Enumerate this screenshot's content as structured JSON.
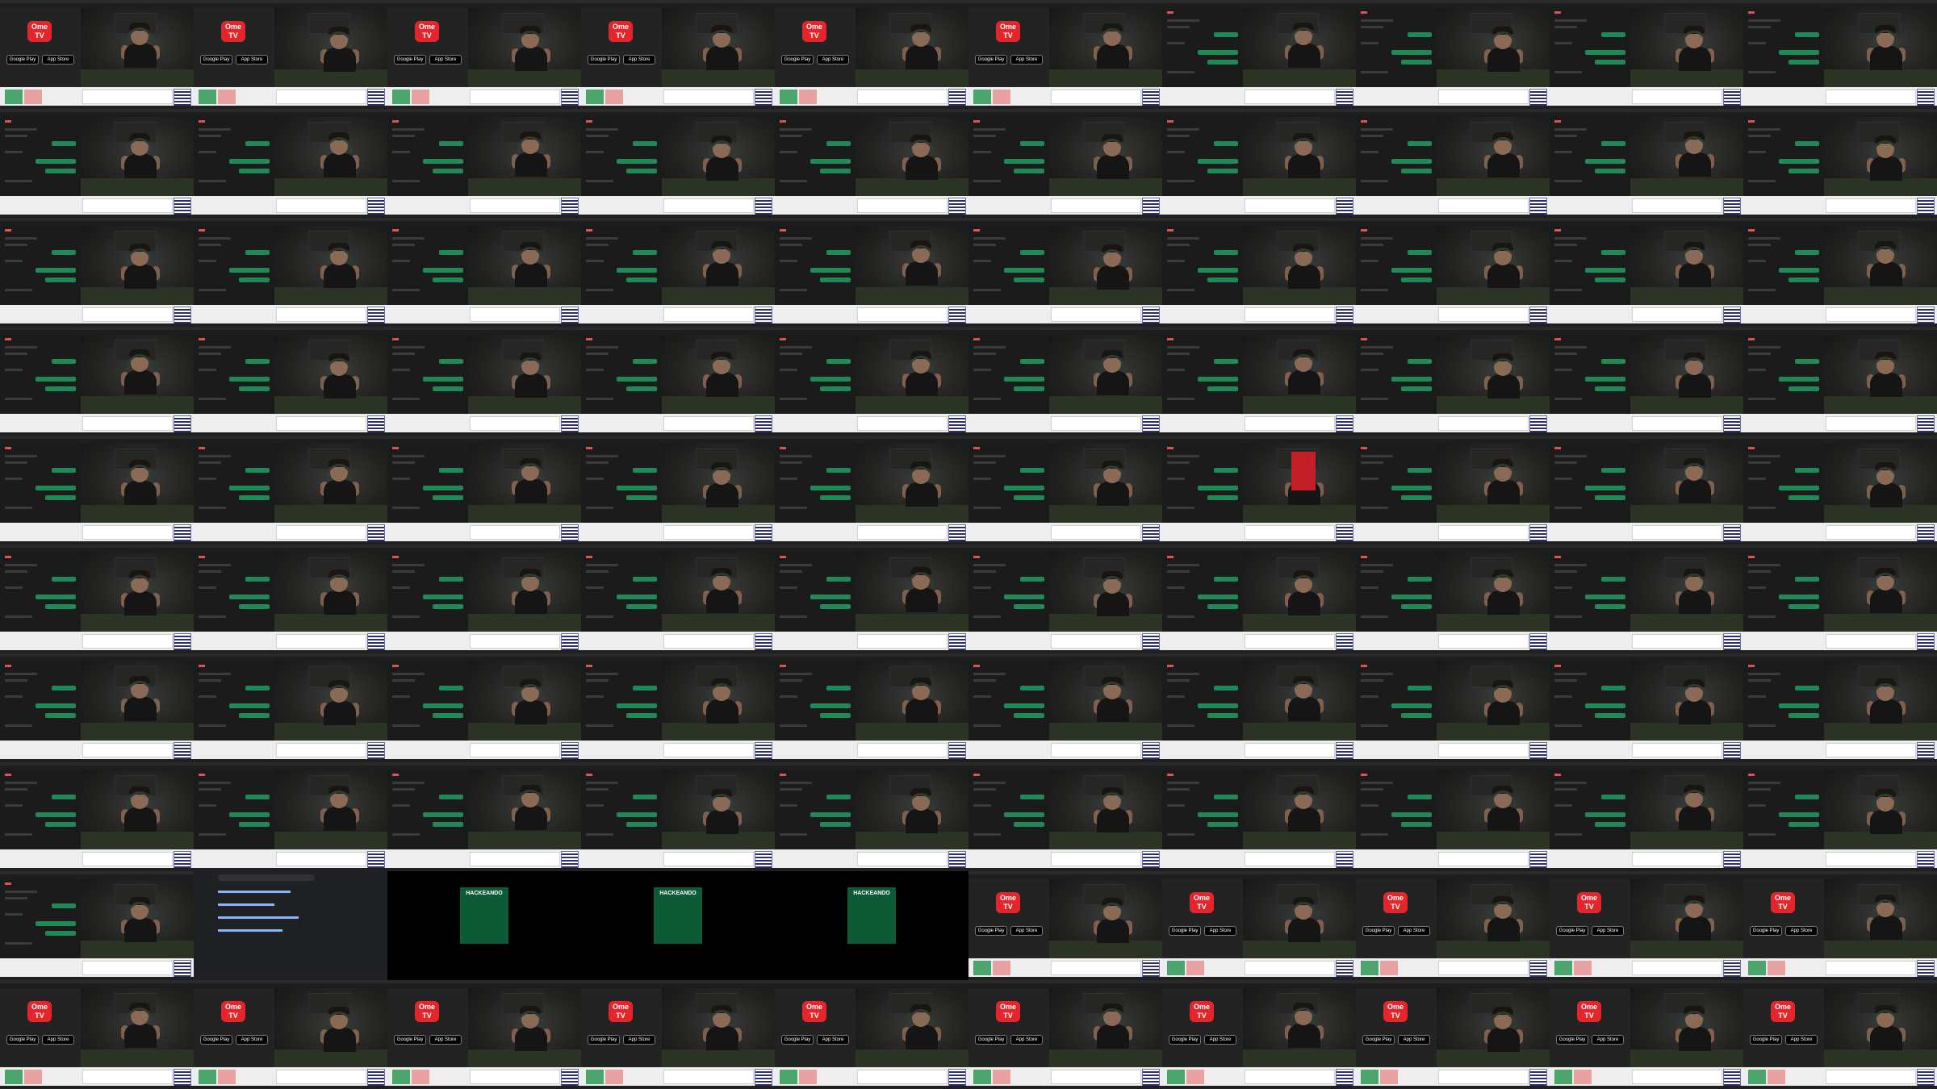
{
  "sheet": {
    "columns": 10,
    "rows": 10,
    "frames": [
      "landing",
      "landing",
      "landing",
      "landing",
      "landing",
      "landing",
      "chat",
      "chat",
      "chat",
      "chat",
      "chat",
      "chat",
      "chat",
      "chat",
      "chat",
      "chat",
      "chat",
      "chat",
      "chat",
      "chat",
      "chat",
      "chat",
      "chat",
      "chat",
      "chat",
      "chat",
      "chat",
      "chat",
      "chat",
      "chat",
      "chat",
      "chat",
      "chat",
      "chat",
      "chat",
      "chat",
      "chat",
      "chat",
      "chat",
      "chat",
      "chat",
      "chat",
      "chat",
      "chat",
      "chat",
      "chat",
      "book",
      "chat",
      "chat",
      "chat",
      "chat",
      "chat",
      "chat",
      "chat",
      "chat",
      "chat",
      "chat",
      "chat",
      "chat",
      "chat",
      "chat",
      "chat",
      "chat",
      "chat",
      "chat",
      "chat",
      "chat",
      "chat",
      "chat",
      "chat",
      "chat",
      "chat",
      "chat",
      "chat",
      "chat",
      "chat",
      "chat",
      "chat",
      "chat",
      "chat",
      "chat",
      "search",
      "thumb",
      "thumb",
      "thumb",
      "landing",
      "landing",
      "landing",
      "landing",
      "landing",
      "landing",
      "landing",
      "landing",
      "landing",
      "landing",
      "landing",
      "landing",
      "landing",
      "landing",
      "landing"
    ]
  },
  "landing": {
    "logo_line1": "Ome",
    "logo_line2": "TV",
    "store_google": "Google Play",
    "store_apple": "App Store"
  },
  "thumbnail": {
    "title": "HACKEANDO"
  },
  "colors": {
    "chat_bubble": "#1f8a55",
    "brand_red": "#e4262c",
    "start_button": "#4aa56b",
    "stop_button": "#e8a0a0",
    "thumbnail_bg": "#0f5a36"
  }
}
